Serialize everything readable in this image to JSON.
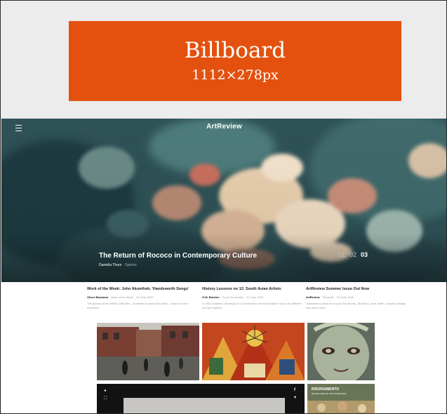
{
  "billboard": {
    "title": "Billboard",
    "size": "1112×278px",
    "color": "#e4510f"
  },
  "hero": {
    "logo": "ArtReview",
    "title": "The Return of Rococo in Contemporary Culture",
    "author": "Daniella Thorn",
    "section": "Opinion",
    "pager": [
      "01",
      "02",
      "03"
    ],
    "pager_active": "03"
  },
  "articles": [
    {
      "headline": "Work of the Week: John Akomfrah, 'Handsworth Songs'",
      "author": "Oliver Basciano",
      "section": "Work of the Week",
      "date": "16 June 2020",
      "dek": "The ghosts of the artist's 1986 film – available to watch this week – have not been exorcised"
    },
    {
      "headline": "History Lessons no 12: South Asian Artists",
      "author": "G.M. Butcher",
      "section": "From the archive",
      "date": "22 June 2020",
      "dek": "A 1962 exhibition (Bombay) in 'A Generation' will be installed: how is he different and yet together"
    },
    {
      "headline": "ArtReview Summer Issue Out Now",
      "author": "ArtReview",
      "section": "Previews",
      "date": "19 June 2020",
      "dek": "Subscribe to what all of your Arm Bonds, Tai Shani, Josh Smith, Claudia Andujar and much more"
    }
  ],
  "promo": {
    "title": "RISORGIMENTO",
    "subtitle": "MILANO VIRTUAL ART EXHIBITION"
  },
  "icons": [
    "menu-icon",
    "facebook-icon",
    "twitter-icon",
    "play-icon",
    "fullscreen-icon"
  ]
}
